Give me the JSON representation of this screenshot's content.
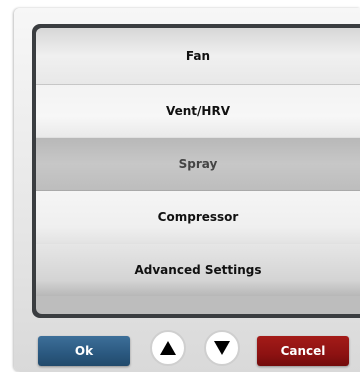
{
  "menu": {
    "items": [
      {
        "label": "Fan"
      },
      {
        "label": "Vent/HRV"
      },
      {
        "label": "Spray",
        "selected": true
      },
      {
        "label": "Compressor"
      },
      {
        "label": "Advanced Settings"
      }
    ]
  },
  "buttons": {
    "ok": "Ok",
    "cancel": "Cancel",
    "up_icon": "triangle-up-icon",
    "down_icon": "triangle-down-icon"
  },
  "colors": {
    "ok": "#2a587f",
    "cancel": "#8d1212",
    "selected_row": "#c0c0c0",
    "frame": "#3a3d40"
  }
}
